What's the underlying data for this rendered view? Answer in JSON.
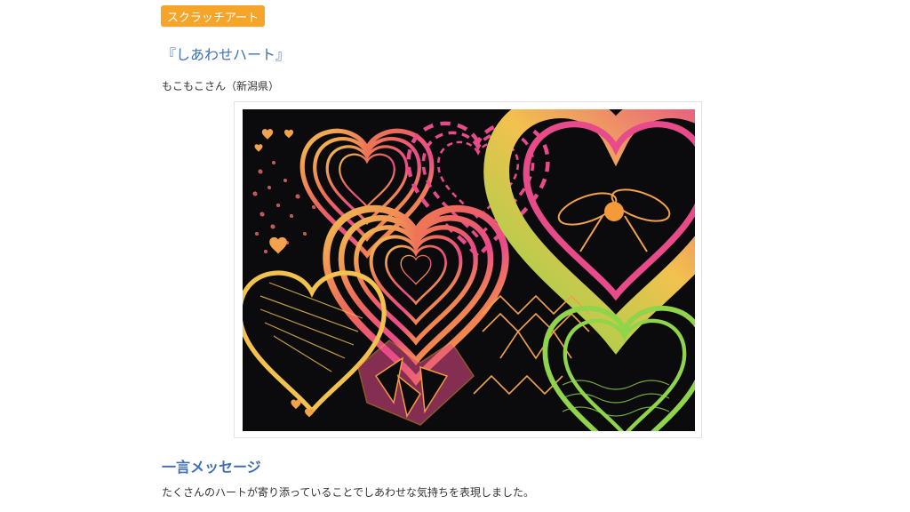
{
  "category": {
    "label": "スクラッチアート"
  },
  "artwork": {
    "title": "『しあわせハート』",
    "author": "もこもこさん（新潟県）",
    "image": {
      "description": "scratch-art-hearts-image",
      "colors": [
        "#f2c14e",
        "#ee6a5a",
        "#e84b8a",
        "#8fd44a",
        "#f59a3a"
      ]
    }
  },
  "message": {
    "heading": "一言メッセージ",
    "body": "たくさんのハートが寄り添っていることでしあわせな気持ちを表現しました。"
  },
  "theme": {
    "accent": "#f5a52a",
    "title_color": "#3f6fb5"
  }
}
